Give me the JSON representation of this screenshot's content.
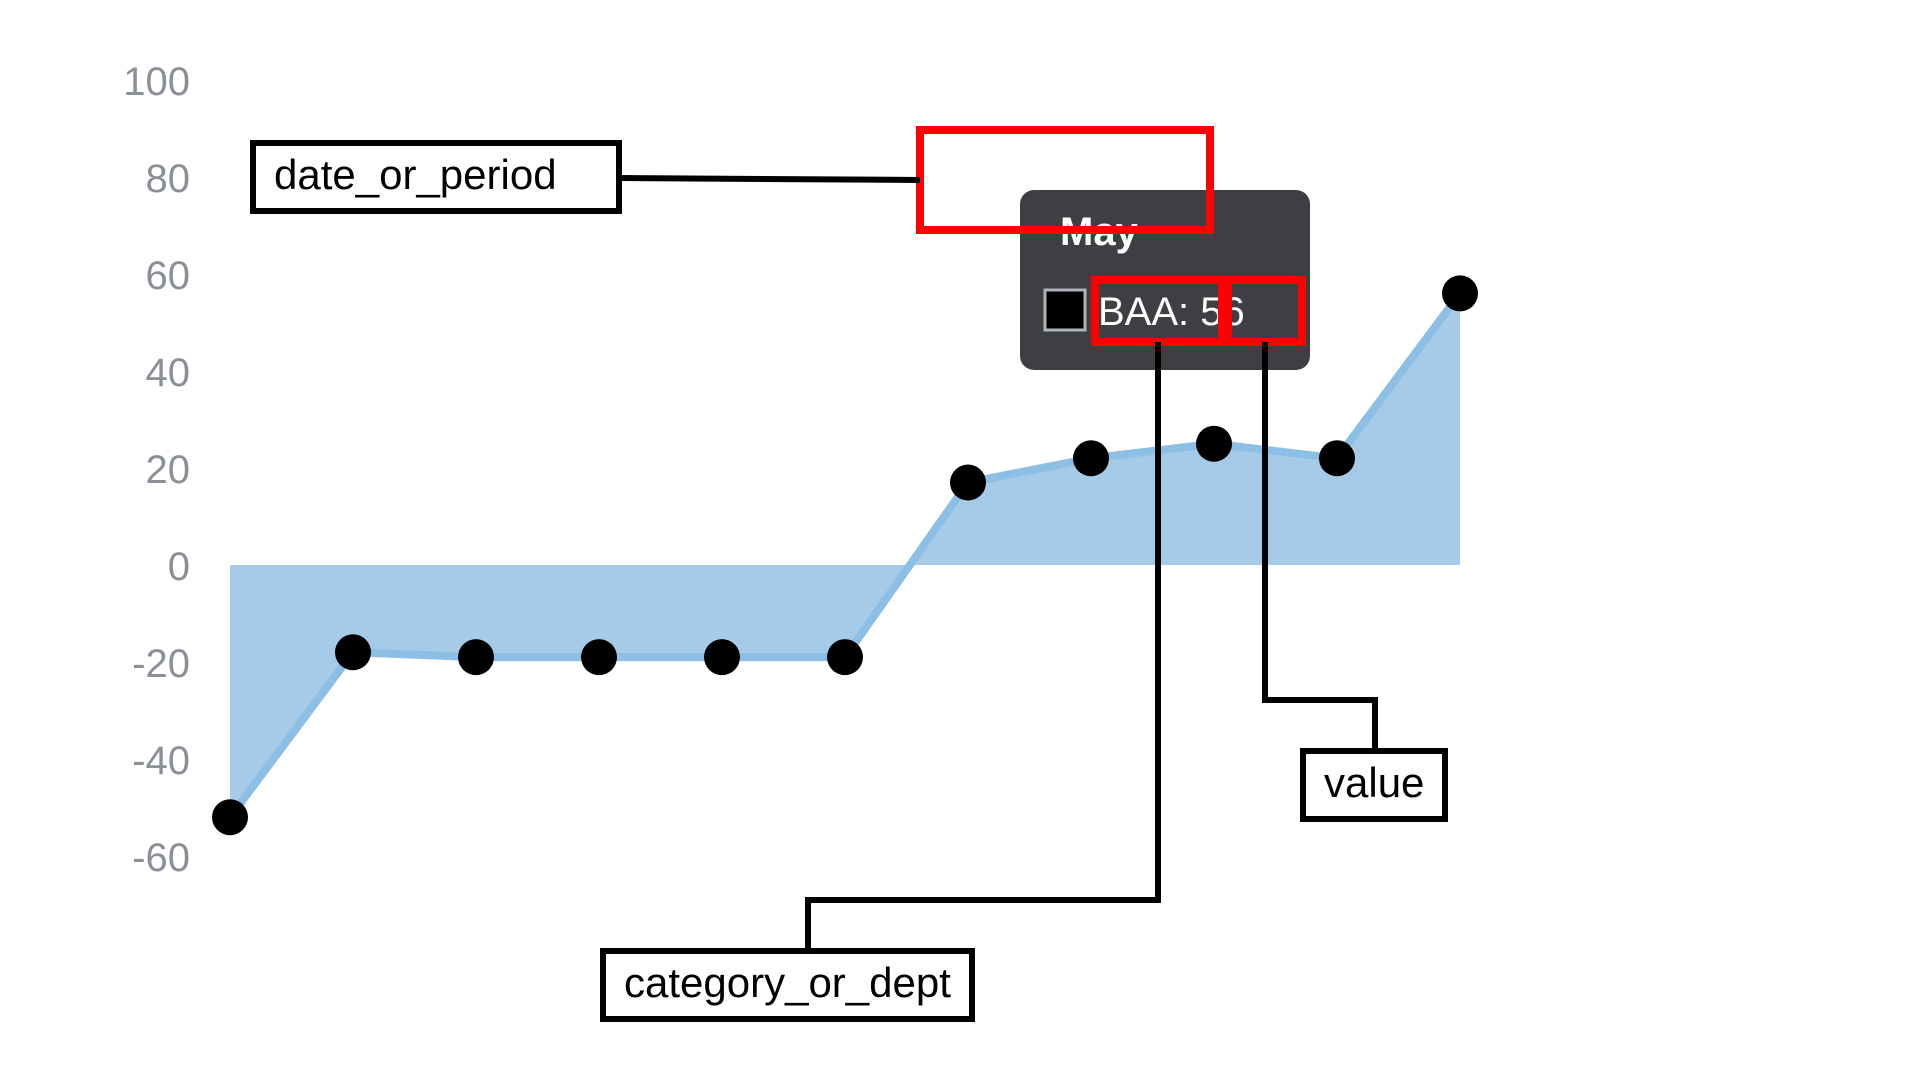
{
  "chart_data": {
    "type": "area",
    "series": [
      {
        "name": "BAA",
        "values": [
          -52,
          -18,
          -19,
          -19,
          -19,
          -19,
          17,
          22,
          25,
          22,
          56
        ]
      }
    ],
    "y_ticks": [
      100,
      80,
      60,
      40,
      20,
      0,
      -20,
      -40,
      -60
    ],
    "ylim": [
      -60,
      100
    ],
    "xlabel": "",
    "ylabel": "",
    "title": "",
    "colors": {
      "area": "#a6cbe9",
      "line": "#8cbfe6",
      "point": "#000000"
    }
  },
  "tooltip": {
    "title": "May",
    "series_label": "BAA:",
    "value": "56"
  },
  "annotations": {
    "date_or_period": "date_or_period",
    "category_or_dept": "category_or_dept",
    "value": "value"
  }
}
